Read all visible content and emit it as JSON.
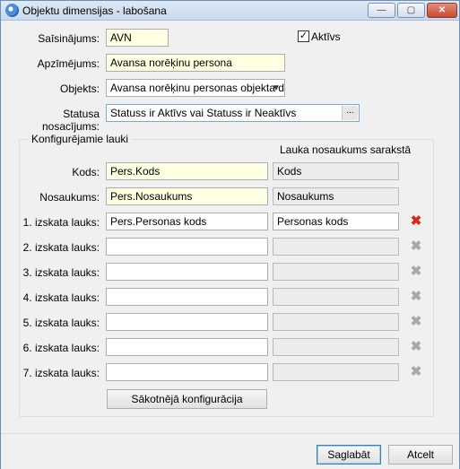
{
  "window": {
    "title": "Objektu dimensijas - labošana",
    "buttons": {
      "minimize": "—",
      "maximize": "▢",
      "close": "✕"
    }
  },
  "form": {
    "saisinajums": {
      "label": "Saīsinājums:",
      "value": "AVN"
    },
    "aktivs": {
      "label": "Aktīvs",
      "checked": true,
      "mark": "✓"
    },
    "apzimejums": {
      "label": "Apzīmējums:",
      "value": "Avansa norēķinu persona"
    },
    "objekts": {
      "label": "Objekts:",
      "value": "Avansa norēķinu personas objekta di"
    },
    "statusa_nosacijums": {
      "label": "Statusa nosacījums:",
      "value": "Statuss ir Aktīvs vai Statuss ir Neaktīvs",
      "button": "..."
    }
  },
  "group": {
    "title": "Konfigurējamie lauki",
    "column_header": "Lauka nosaukums sarakstā",
    "rows": [
      {
        "label": "Kods:",
        "value": "Pers.Kods",
        "name": "Kods",
        "delete": "none"
      },
      {
        "label": "Nosaukums:",
        "value": "Pers.Nosaukums",
        "name": "Nosaukums",
        "delete": "none"
      },
      {
        "label": "1. izskata lauks:",
        "value": "Pers.Personas kods",
        "name": "Personas kods",
        "delete": "active"
      },
      {
        "label": "2. izskata lauks:",
        "value": "",
        "name": "",
        "delete": "inactive"
      },
      {
        "label": "3. izskata lauks:",
        "value": "",
        "name": "",
        "delete": "inactive"
      },
      {
        "label": "4. izskata lauks:",
        "value": "",
        "name": "",
        "delete": "inactive"
      },
      {
        "label": "5. izskata lauks:",
        "value": "",
        "name": "",
        "delete": "inactive"
      },
      {
        "label": "6. izskata lauks:",
        "value": "",
        "name": "",
        "delete": "inactive"
      },
      {
        "label": "7. izskata lauks:",
        "value": "",
        "name": "",
        "delete": "inactive"
      }
    ],
    "reset_button": "Sākotnējā konfigurācija"
  },
  "footer": {
    "save": "Saglabāt",
    "cancel": "Atcelt"
  },
  "icons": {
    "delete": "delete-icon",
    "dropdown": "chevron-down-icon"
  }
}
